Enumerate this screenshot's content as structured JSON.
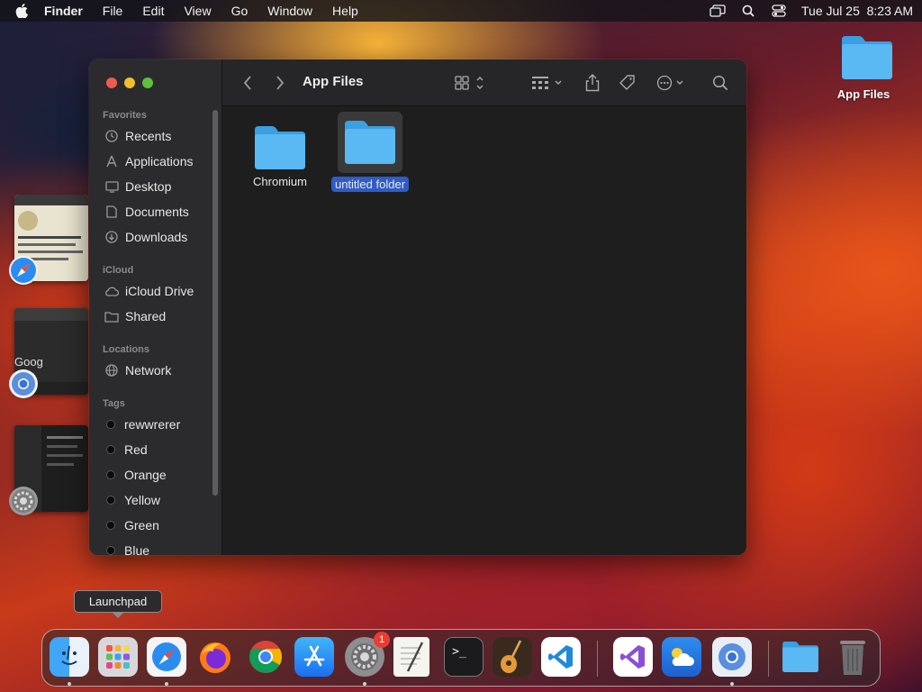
{
  "menubar": {
    "app": "Finder",
    "items": [
      "File",
      "Edit",
      "View",
      "Go",
      "Window",
      "Help"
    ],
    "datetime": "Tue Jul 25  8:23 AM",
    "status_icons": [
      "screen-mirroring-icon",
      "spotlight-icon",
      "control-center-icon"
    ]
  },
  "desktop": {
    "folder_label": "App Files"
  },
  "stage_manager": {
    "apps": [
      "Safari",
      "Chromium",
      "System Settings"
    ],
    "google_text": "Goog"
  },
  "finder": {
    "title": "App Files",
    "sidebar": {
      "favorites_label": "Favorites",
      "favorites": [
        "Recents",
        "Applications",
        "Desktop",
        "Documents",
        "Downloads"
      ],
      "icloud_label": "iCloud",
      "icloud": [
        "iCloud Drive",
        "Shared"
      ],
      "locations_label": "Locations",
      "locations": [
        "Network"
      ],
      "tags_label": "Tags",
      "tags": [
        "rewwrerer",
        "Red",
        "Orange",
        "Yellow",
        "Green",
        "Blue"
      ]
    },
    "files": [
      {
        "name": "Chromium",
        "selected": false
      },
      {
        "name": "untitled folder",
        "selected": true
      }
    ]
  },
  "tooltip": {
    "text": "Launchpad"
  },
  "dock": {
    "apps": [
      "Finder",
      "Launchpad",
      "Safari",
      "Firefox",
      "Chrome",
      "App Store",
      "System Settings",
      "TextEdit",
      "Terminal",
      "GarageBand",
      "Visual Studio Code",
      "Visual Studio",
      "Weather",
      "Chromium",
      "App Files",
      "Trash"
    ],
    "settings_badge": "1"
  }
}
